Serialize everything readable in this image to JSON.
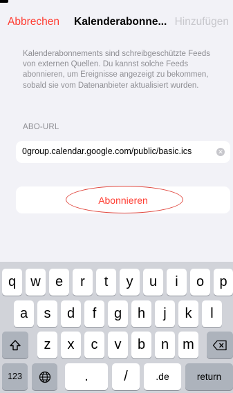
{
  "nav": {
    "cancel_label": "Abbrechen",
    "title": "Kalenderabonne...",
    "add_label": "Hinzufügen"
  },
  "description": "Kalenderabonnements sind schreibgeschützte Feeds von externen Quellen. Du kannst solche Feeds abonnieren, um Ereignisse angezeigt zu bekommen, sobald sie vom Datenanbieter aktualisiert wurden.",
  "url_section": {
    "label": "ABO-URL",
    "value": "0group.calendar.google.com/public/basic.ics"
  },
  "subscribe_label": "Abonnieren",
  "keyboard": {
    "row1": [
      "q",
      "w",
      "e",
      "r",
      "t",
      "y",
      "u",
      "i",
      "o",
      "p"
    ],
    "row2": [
      "a",
      "s",
      "d",
      "f",
      "g",
      "h",
      "j",
      "k",
      "l"
    ],
    "row3": [
      "z",
      "x",
      "c",
      "v",
      "b",
      "n",
      "m"
    ],
    "numbers_label": "123",
    "period_label": ".",
    "slash_label": "/",
    "domain_label": ".de",
    "return_label": "return"
  },
  "icons": {
    "clear": "clear-text-icon",
    "shift": "shift-icon",
    "delete": "delete-icon",
    "globe": "globe-icon"
  }
}
